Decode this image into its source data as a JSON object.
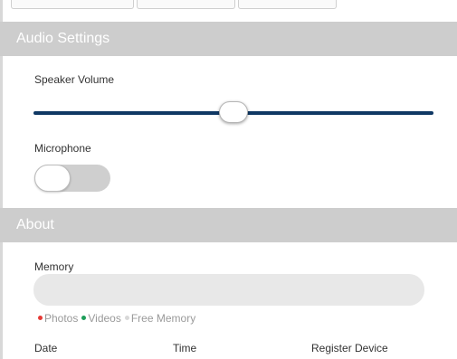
{
  "audio_settings": {
    "title": "Audio Settings",
    "speaker_volume": {
      "label": "Speaker Volume",
      "value_percent": 50
    },
    "microphone": {
      "label": "Microphone",
      "enabled": false
    }
  },
  "about": {
    "title": "About",
    "memory": {
      "label": "Memory",
      "legend": [
        {
          "label": "Photos",
          "color": "#e53935"
        },
        {
          "label": "Videos",
          "color": "#1e9e5a"
        },
        {
          "label": "Free Memory",
          "color": "#d8d8d8"
        }
      ]
    },
    "table": {
      "columns": [
        "Date",
        "Time",
        "Register Device"
      ]
    }
  },
  "colors": {
    "header_bg": "#cdcdcd",
    "slider_track": "#0f3864",
    "toggle_off": "#cfcfcf",
    "memory_bar_bg": "#e8e8e8"
  }
}
